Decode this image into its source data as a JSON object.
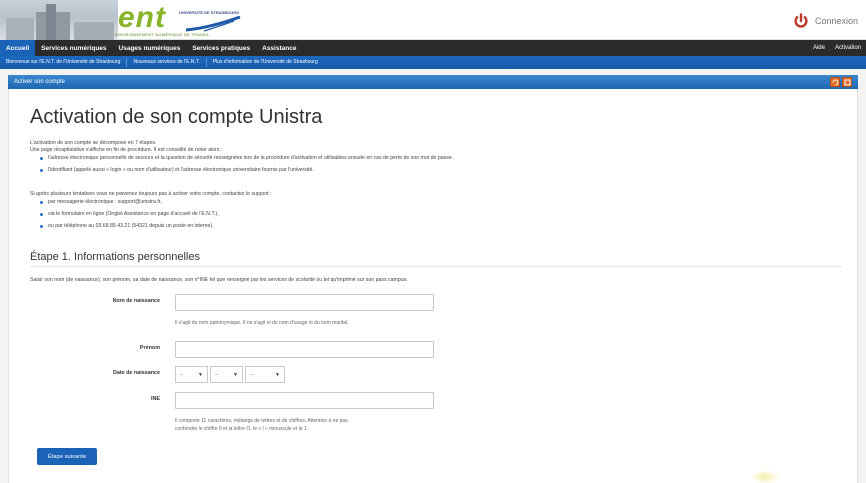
{
  "header": {
    "logo_text": "ent",
    "logo_subtitle": "ENVIRONNEMENT NUMÉRIQUE DE TRAVAIL",
    "university": "UNIVERSITÉ DE STRASBOURG",
    "connexion_label": "Connexion",
    "accent_color": "#c0392b"
  },
  "topnav": {
    "items": [
      "Accueil",
      "Services numériques",
      "Usages numériques",
      "Services pratiques",
      "Assistance"
    ],
    "right_items": [
      "Aide",
      "Activation"
    ],
    "active_index": 0
  },
  "subnav": {
    "items": [
      "Bienvenue sur l'E.N.T. de l'Université de Strasbourg",
      "Nouveaux services de l'E.N.T.",
      "Plus d'information de l'Université de Strasbourg"
    ]
  },
  "portlet": {
    "title": "Activer son compte"
  },
  "main": {
    "title": "Activation de son compte Unistra",
    "intro_line1": "L'activation de son compte se décompose en 7 étapes.",
    "intro_line2": "Une page récapitulative s'affiche en fin de procédure. Il est conseillé de noter alors :",
    "intro_bullets": [
      "l'adresse électronique personnelle de secours et la question de sécurité renseignées lors de la procédure d'activation et utilisables ensuite en cas de perte de son mot de passe.",
      "l'identifiant (appelé aussi « login » ou nom d'utilisateur) et l'adresse électronique universitaire fournis par l'université."
    ],
    "support_line": "Si après plusieurs tentatives vous ne parvenez toujours pas à activer votre compte, contactez le support :",
    "support_bullets": [
      "par messagerie électronique : support@unistra.fr,",
      "via le formulaire en ligne (Onglet Assistance en page d'accueil de l'E.N.T.),",
      "ou par téléphone au 03.68.85.43.21 (54321 depuis un poste en interne)."
    ]
  },
  "step": {
    "title": "Étape 1. Informations personnelles",
    "instructions": "Saisir son nom (de naissance), son prénom, sa date de naissance, son n°INE tel que renseigné par les services de scolarité ou tel qu'imprimé sur son pass campus.",
    "fields": {
      "nom_label": "Nom de naissance",
      "nom_value": "",
      "nom_help": "Il s'agit du nom patronymique. Il ne s'agit ni du nom d'usage ni du nom marital.",
      "prenom_label": "Prénom",
      "prenom_value": "",
      "date_label": "Date de naissance",
      "date_day": "--",
      "date_month": "--",
      "date_year": "--",
      "ine_label": "INE",
      "ine_value": "",
      "ine_help_line1": "Il comporte 11 caractères, mélange de lettres et de chiffres. Attention à ne pas",
      "ine_help_line2": "confondre le chiffre 0 et la lettre O, le « l » minuscule et le 1."
    },
    "next_button": "Étape suivante"
  }
}
